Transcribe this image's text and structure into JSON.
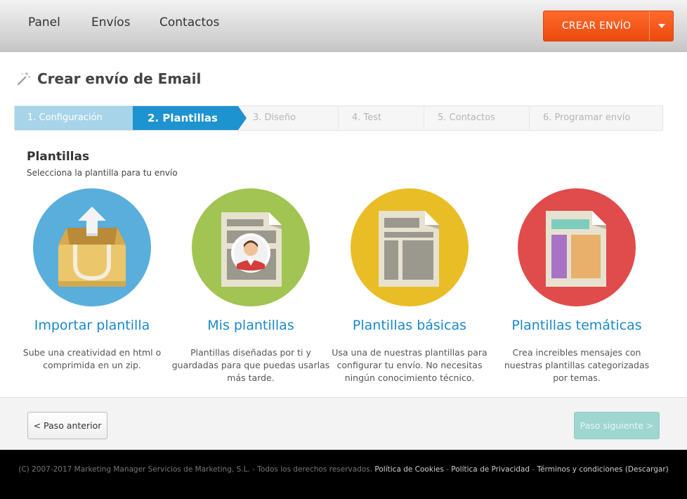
{
  "nav": {
    "items": [
      "Panel",
      "Envíos",
      "Contactos"
    ],
    "create_label": "CREAR ENVÍO"
  },
  "page": {
    "title": "Crear envío de Email"
  },
  "stepper": {
    "steps": [
      "1. Configuración",
      "2. Plantillas",
      "3. Diseño",
      "4. Test",
      "5. Contactos",
      "6. Programar envío"
    ],
    "active_index": 1
  },
  "section": {
    "title": "Plantillas",
    "subtitle": "Selecciona la plantilla para tu envío"
  },
  "cards": [
    {
      "title": "Importar plantilla",
      "desc": "Sube una creatividad en html o comprimida en un zip.",
      "color": "#5aaedc",
      "icon": "box-upload-icon"
    },
    {
      "title": "Mis plantillas",
      "desc": "Plantillas diseñadas por ti y guardadas para que puedas usarlas más tarde.",
      "color": "#a1c452",
      "icon": "user-template-icon"
    },
    {
      "title": "Plantillas básicas",
      "desc": "Usa una de nuestras plantillas para configurar tu envío. No necesitas ningún conocimiento técnico.",
      "color": "#e9bd26",
      "icon": "basic-template-icon"
    },
    {
      "title": "Plantillas temáticas",
      "desc": "Crea increibles mensajes con nuestras plantillas categorizadas por temas.",
      "color": "#e04b4b",
      "icon": "themed-template-icon"
    }
  ],
  "buttons": {
    "prev": "< Paso anterior",
    "next": "Paso siguiente >"
  },
  "footer": {
    "copyright": "(C) 2007-2017 Marketing Manager Servicios de Marketing, S.L. - Todos los derechos reservados.",
    "links": [
      "Política de Cookies",
      "Política de Privacidad",
      "Términos y condiciones",
      "(Descargar)"
    ]
  }
}
